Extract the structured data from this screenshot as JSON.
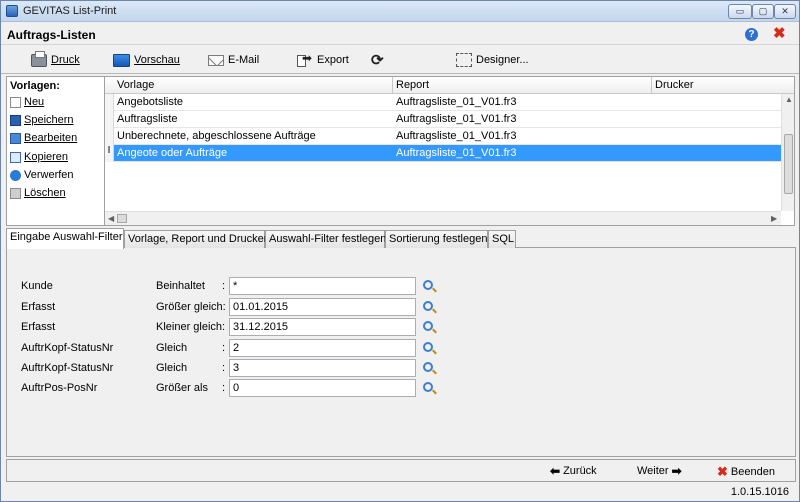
{
  "window": {
    "title": "GEVITAS List-Print",
    "min": "▭",
    "max": "▢",
    "close": "✕"
  },
  "header": {
    "title": "Auftrags-Listen"
  },
  "toolbar": {
    "print_label": "Druck",
    "preview_label": "Vorschau",
    "email_label": "E-Mail",
    "export_label": "Export",
    "refresh_glyph": "⟳",
    "designer_label": "Designer..."
  },
  "sidebar": {
    "title": "Vorlagen:",
    "items": [
      {
        "label": "Neu",
        "icon": "new-document-icon"
      },
      {
        "label": "Speichern",
        "icon": "save-icon"
      },
      {
        "label": "Bearbeiten",
        "icon": "edit-icon"
      },
      {
        "label": "Kopieren",
        "icon": "copy-icon"
      },
      {
        "label": "Verwerfen",
        "icon": "discard-icon"
      },
      {
        "label": "Löschen",
        "icon": "delete-icon"
      }
    ]
  },
  "grid": {
    "columns": [
      "Vorlage",
      "Report",
      "Drucker"
    ],
    "rows": [
      {
        "vorlage": "Angebotsliste",
        "report": "Auftragsliste_01_V01.fr3",
        "drucker": ""
      },
      {
        "vorlage": "Auftragsliste",
        "report": "Auftragsliste_01_V01.fr3",
        "drucker": ""
      },
      {
        "vorlage": "Unberechnete, abgeschlossene Aufträge",
        "report": "Auftragsliste_01_V01.fr3",
        "drucker": ""
      },
      {
        "vorlage": "Angeote oder Aufträge",
        "report": "Auftragsliste_01_V01.fr3",
        "drucker": "",
        "marker": "I"
      }
    ]
  },
  "tabs": [
    "Eingabe Auswahl-Filter",
    "Vorlage, Report und Drucker",
    "Auswahl-Filter festlegen",
    "Sortierung festlegen",
    "SQL"
  ],
  "filters": [
    {
      "field": "Kunde",
      "op": "Beinhaltet",
      "colon": ":",
      "value": "*"
    },
    {
      "field": "Erfasst",
      "op": "Größer gleich:",
      "colon": "",
      "value": "01.01.2015"
    },
    {
      "field": "Erfasst",
      "op": "Kleiner gleich:",
      "colon": "",
      "value": "31.12.2015"
    },
    {
      "field": "AuftrKopf-StatusNr",
      "op": "Gleich",
      "colon": ":",
      "value": "2"
    },
    {
      "field": "AuftrKopf-StatusNr",
      "op": "Gleich",
      "colon": ":",
      "value": "3"
    },
    {
      "field": "AuftrPos-PosNr",
      "op": "Größer als",
      "colon": ":",
      "value": "0"
    }
  ],
  "footer": {
    "back_label": "Zurück",
    "next_label": "Weiter",
    "exit_label": "Beenden",
    "back_arrow": "⬅",
    "next_arrow": "➡",
    "exit_glyph": "✖"
  },
  "status": {
    "version": "1.0.15.1016"
  },
  "colors": {
    "selection": "#3399ff",
    "close_red": "#d62a1a",
    "help_blue": "#2f6fcf"
  }
}
